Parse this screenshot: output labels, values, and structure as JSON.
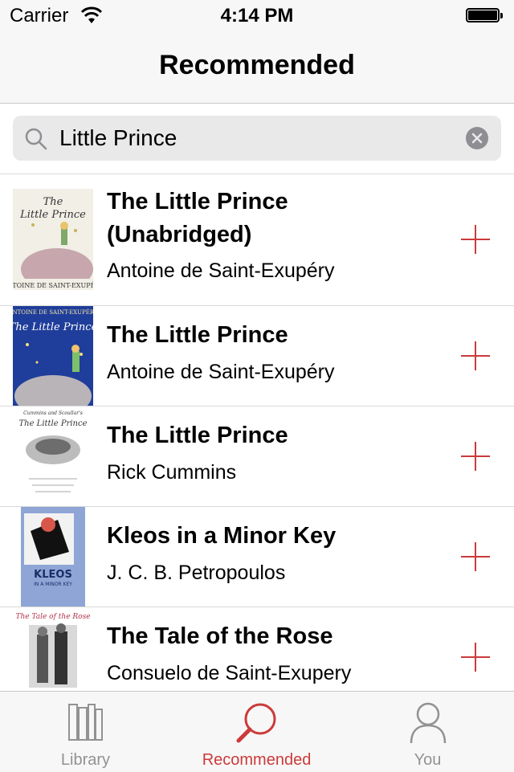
{
  "status_bar": {
    "carrier": "Carrier",
    "time": "4:14 PM"
  },
  "nav": {
    "title": "Recommended"
  },
  "search": {
    "value": "Little Prince"
  },
  "books": [
    {
      "title_line1": "The Little Prince",
      "title_line2": "(Unabridged)",
      "author": "Antoine de Saint-Exupéry"
    },
    {
      "title": "The Little Prince",
      "author": "Antoine de Saint-Exupéry"
    },
    {
      "title": "The Little Prince",
      "author": "Rick Cummins"
    },
    {
      "title": "Kleos in a Minor Key",
      "author": "J. C. B. Petropoulos"
    },
    {
      "title": "The Tale of the Rose",
      "author": "Consuelo de Saint-Exupery"
    }
  ],
  "tabs": [
    {
      "label": "Library",
      "icon": "books-icon"
    },
    {
      "label": "Recommended",
      "icon": "magnifier-icon"
    },
    {
      "label": "You",
      "icon": "person-icon"
    }
  ],
  "colors": {
    "accent": "#cc3a3a",
    "tab_inactive": "#929292",
    "bar_background": "#f7f7f7"
  }
}
